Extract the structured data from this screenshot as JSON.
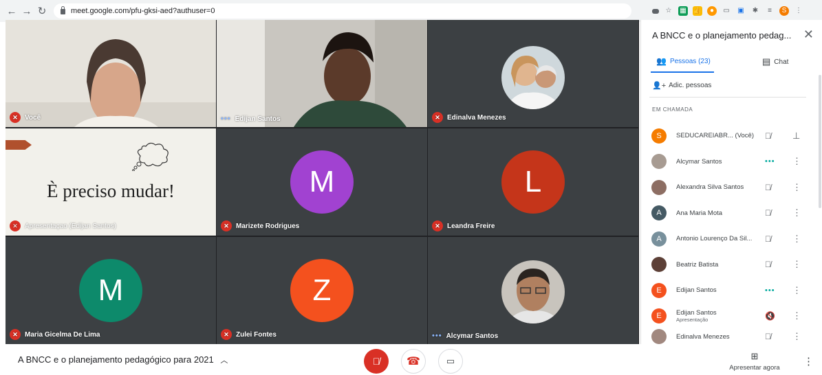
{
  "browser": {
    "url": "meet.google.com/pfu-gksi-aed?authuser=0"
  },
  "tiles": [
    {
      "name": "Você",
      "mic": "muted"
    },
    {
      "name": "Edijan Santos",
      "mic": "talking"
    },
    {
      "name": "Edinalva Menezes",
      "mic": "muted"
    },
    {
      "name": "Apresentaçao (Edijan Santos)",
      "mic": "muted"
    },
    {
      "name": "Marizete Rodrigues",
      "mic": "muted",
      "initial": "M",
      "color": "#a142d1"
    },
    {
      "name": "Leandra Freire",
      "mic": "muted",
      "initial": "L",
      "color": "#c5351a"
    },
    {
      "name": "Maria Gicelma De Lima",
      "mic": "muted",
      "initial": "M",
      "color": "#0d8a6b"
    },
    {
      "name": "Zulei Fontes",
      "mic": "muted",
      "initial": "Z",
      "color": "#f4511e"
    },
    {
      "name": "Alcymar Santos",
      "mic": "talking"
    }
  ],
  "slide": {
    "title": "È preciso mudar!"
  },
  "panel": {
    "title": "A BNCC e o planejamento pedag...",
    "tab_people": "Pessoas (23)",
    "tab_chat": "Chat",
    "add_people": "Adic. pessoas",
    "section": "EM CHAMADA",
    "people": [
      {
        "name": "SEDUCAREIABR...",
        "suffix": "(Você)",
        "initial": "S",
        "color": "#f57c00",
        "status": "muted",
        "extra": "pin"
      },
      {
        "name": "Alcymar Santos",
        "initial": "",
        "color": "#9e9e9e",
        "status": "talking"
      },
      {
        "name": "Alexandra Silva Santos",
        "initial": "",
        "color": "#8d6e63",
        "status": "muted"
      },
      {
        "name": "Ana Maria Mota",
        "initial": "A",
        "color": "#455a64",
        "status": "muted"
      },
      {
        "name": "Antonio Lourenço Da Sil...",
        "initial": "A",
        "color": "#78909c",
        "status": "muted"
      },
      {
        "name": "Beatriz Batista",
        "initial": "",
        "color": "#5d4037",
        "status": "muted"
      },
      {
        "name": "Edijan Santos",
        "initial": "E",
        "color": "#f4511e",
        "status": "talking"
      },
      {
        "name": "Edijan Santos",
        "sub": "Apresentação",
        "initial": "E",
        "color": "#f4511e",
        "status": "present"
      },
      {
        "name": "Edinalva Menezes",
        "initial": "",
        "color": "#a1887f",
        "status": "muted"
      }
    ]
  },
  "bottom": {
    "meeting_title": "A BNCC e o planejamento pedagógico para 2021",
    "present_label": "Apresentar agora"
  }
}
